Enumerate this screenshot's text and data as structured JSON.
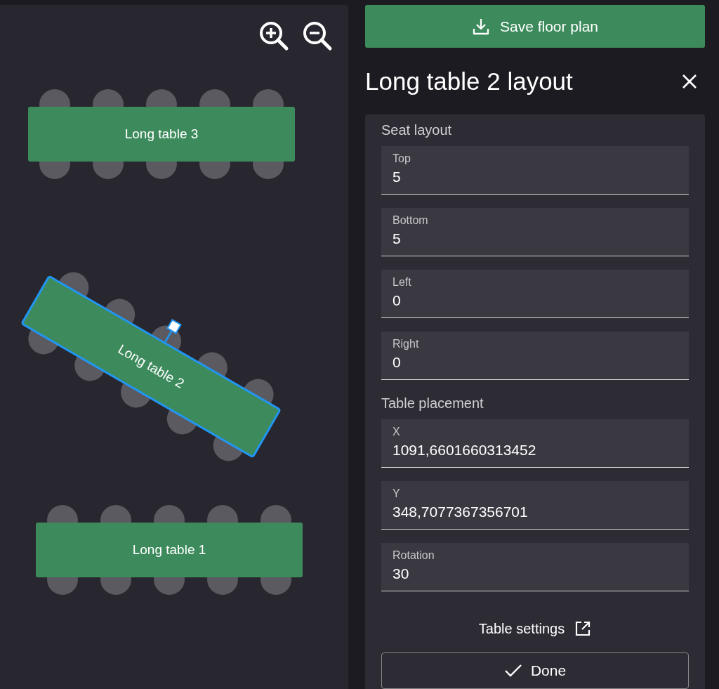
{
  "canvas": {
    "tables": [
      {
        "label": "Long table 3",
        "selected": false
      },
      {
        "label": "Long table 2",
        "selected": true
      },
      {
        "label": "Long table 1",
        "selected": false
      }
    ]
  },
  "save_button": "Save floor plan",
  "panel": {
    "title": "Long table 2 layout",
    "sections": [
      {
        "heading": "Seat layout",
        "fields": [
          {
            "label": "Top",
            "value": "5"
          },
          {
            "label": "Bottom",
            "value": "5"
          },
          {
            "label": "Left",
            "value": "0"
          },
          {
            "label": "Right",
            "value": "0"
          }
        ]
      },
      {
        "heading": "Table placement",
        "fields": [
          {
            "label": "X",
            "value": "1091,6601660313452"
          },
          {
            "label": "Y",
            "value": "348,7077367356701"
          },
          {
            "label": "Rotation",
            "value": "30"
          }
        ]
      }
    ],
    "link": "Table settings",
    "done_button": "Done"
  }
}
